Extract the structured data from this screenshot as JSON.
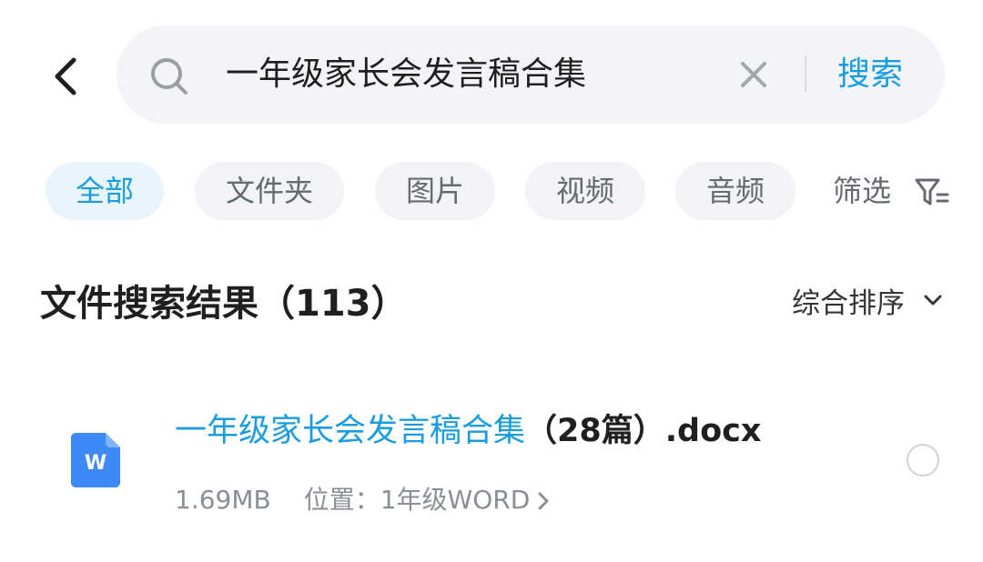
{
  "search": {
    "query": "一年级家长会发言稿合集",
    "search_button_label": "搜索"
  },
  "filters": {
    "chips": [
      "全部",
      "文件夹",
      "图片",
      "视频",
      "音频"
    ],
    "active_index": 0,
    "filter_label": "筛选"
  },
  "results": {
    "title": "文件搜索结果（113）",
    "sort_label": "综合排序",
    "items": [
      {
        "name_highlight": "一年级家长会发言稿合集",
        "name_rest": "（28篇）.docx",
        "size": "1.69MB",
        "location": "位置：1年级WORD",
        "icon_letter": "W"
      }
    ]
  },
  "colors": {
    "accent": "#1a9de0",
    "word_icon": "#3d8af7"
  }
}
